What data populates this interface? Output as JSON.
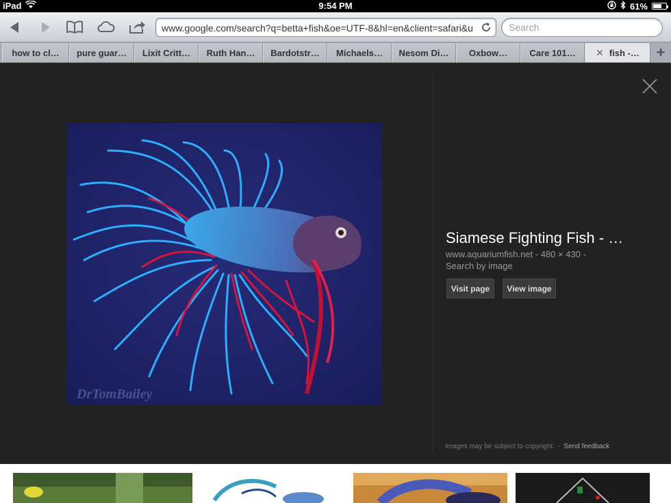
{
  "status": {
    "device": "iPad",
    "time": "9:54 PM",
    "battery": "61%"
  },
  "browser": {
    "url": "www.google.com/search?q=betta+fish&oe=UTF-8&hl=en&client=safari&u",
    "search_placeholder": "Search"
  },
  "tabs": [
    {
      "label": "how to cl…"
    },
    {
      "label": "pure guar…"
    },
    {
      "label": "Lixit Critt…"
    },
    {
      "label": "Ruth Han…"
    },
    {
      "label": "Bardotstr…"
    },
    {
      "label": "Michaels…"
    },
    {
      "label": "Nesom Di…"
    },
    {
      "label": "Oxbow…"
    },
    {
      "label": "Care 101…"
    },
    {
      "label": "fish -…",
      "close": "✕",
      "active": true
    }
  ],
  "new_tab": "+",
  "viewer": {
    "title": "Siamese Fighting Fish - …",
    "meta": "www.aquariumfish.net - 480 × 430 -",
    "search_by_image": "Search by image",
    "visit_page": "Visit page",
    "view_image": "View image",
    "copyright": "Images may be subject to copyright.",
    "separator": "-",
    "feedback": "Send feedback",
    "watermark": "DrTomBailey"
  },
  "colors": {
    "image_bg": "#1f2366",
    "fin_blue": "#2bb0ff",
    "fin_red": "#d8143c",
    "viewer_bg": "#222222"
  }
}
